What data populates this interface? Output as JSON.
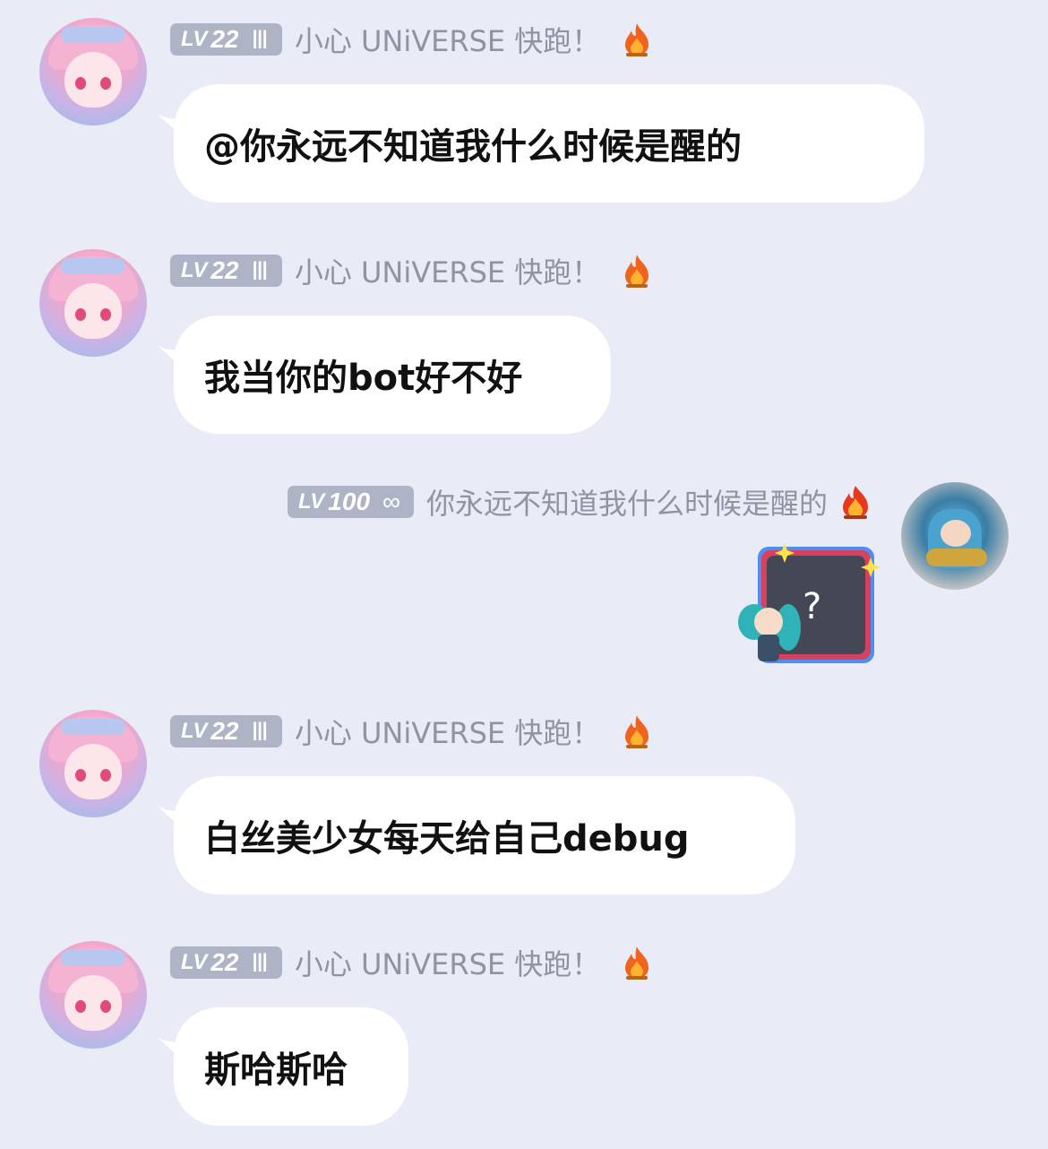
{
  "messages": [
    {
      "level_tag": "LV",
      "level": "22",
      "level_mark": "Ⅲ",
      "username": "小心 UNiVERSE 快跑！",
      "text": "@你永远不知道我什么时候是醒的"
    },
    {
      "level_tag": "LV",
      "level": "22",
      "level_mark": "Ⅲ",
      "username": "小心 UNiVERSE 快跑！",
      "text": "我当你的bot好不好"
    },
    {
      "level_tag": "LV",
      "level": "100",
      "level_mark": "∞",
      "username": "你永远不知道我什么时候是醒的",
      "sticker_symbol": "?"
    },
    {
      "level_tag": "LV",
      "level": "22",
      "level_mark": "Ⅲ",
      "username": "小心 UNiVERSE 快跑！",
      "text": "白丝美少女每天给自己debug"
    },
    {
      "level_tag": "LV",
      "level": "22",
      "level_mark": "Ⅲ",
      "username": "小心 UNiVERSE 快跑！",
      "text": "斯哈斯哈"
    }
  ],
  "icons": {
    "fire": "fire-icon",
    "avatar_left": "anime-girl-avatar",
    "avatar_right": "plush-figure-avatar",
    "sticker": "mystery-box-sticker"
  },
  "colors": {
    "background": "#e9ebf6",
    "bubble": "#ffffff",
    "badge": "#aeb3c6",
    "username": "#8f93a2"
  }
}
